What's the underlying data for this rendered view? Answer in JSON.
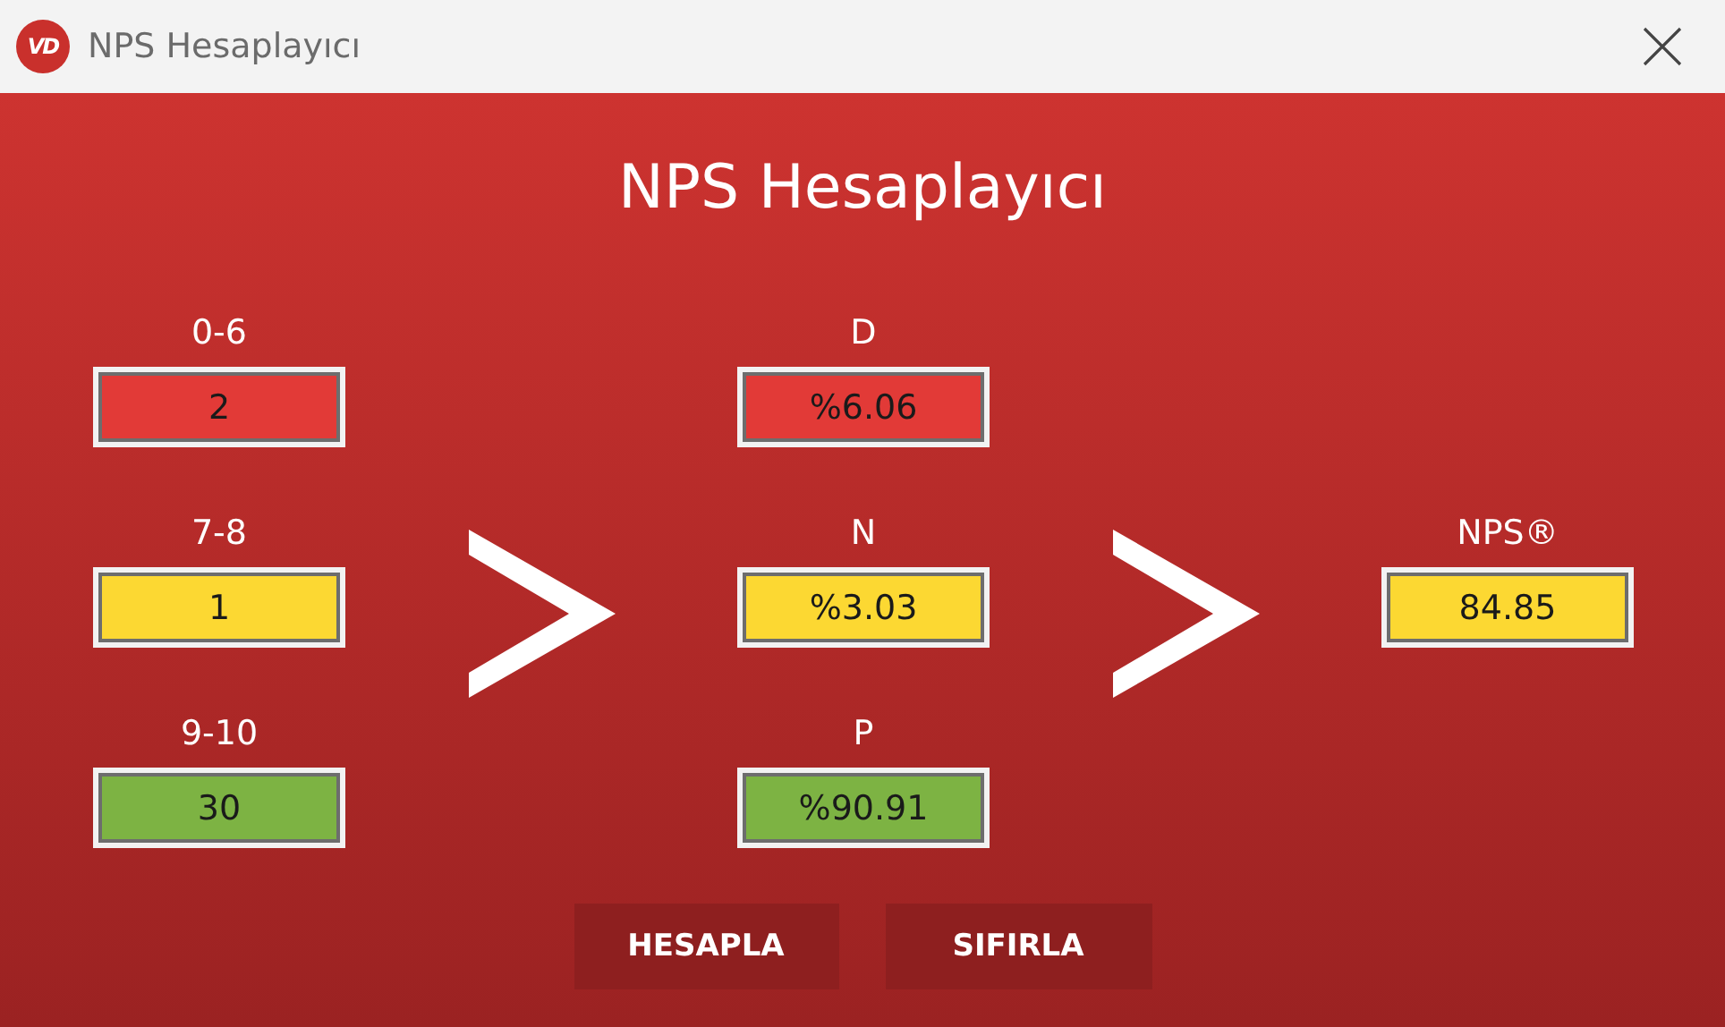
{
  "window": {
    "logo_text": "VD",
    "title": "NPS Hesaplayıcı"
  },
  "heading": "NPS Hesaplayıcı",
  "inputs": [
    {
      "label": "0-6",
      "value": "2",
      "color": "#e23a37"
    },
    {
      "label": "7-8",
      "value": "1",
      "color": "#fcd832"
    },
    {
      "label": "9-10",
      "value": "30",
      "color": "#7db343"
    }
  ],
  "results": [
    {
      "label": "D",
      "value": "%6.06",
      "color": "#e23a37"
    },
    {
      "label": "N",
      "value": "%3.03",
      "color": "#fcd832"
    },
    {
      "label": "P",
      "value": "%90.91",
      "color": "#7db343"
    }
  ],
  "nps": {
    "label": "NPS®",
    "value": "84.85",
    "color": "#fcd832"
  },
  "buttons": [
    "HESAPLA",
    "SIFIRLA"
  ]
}
